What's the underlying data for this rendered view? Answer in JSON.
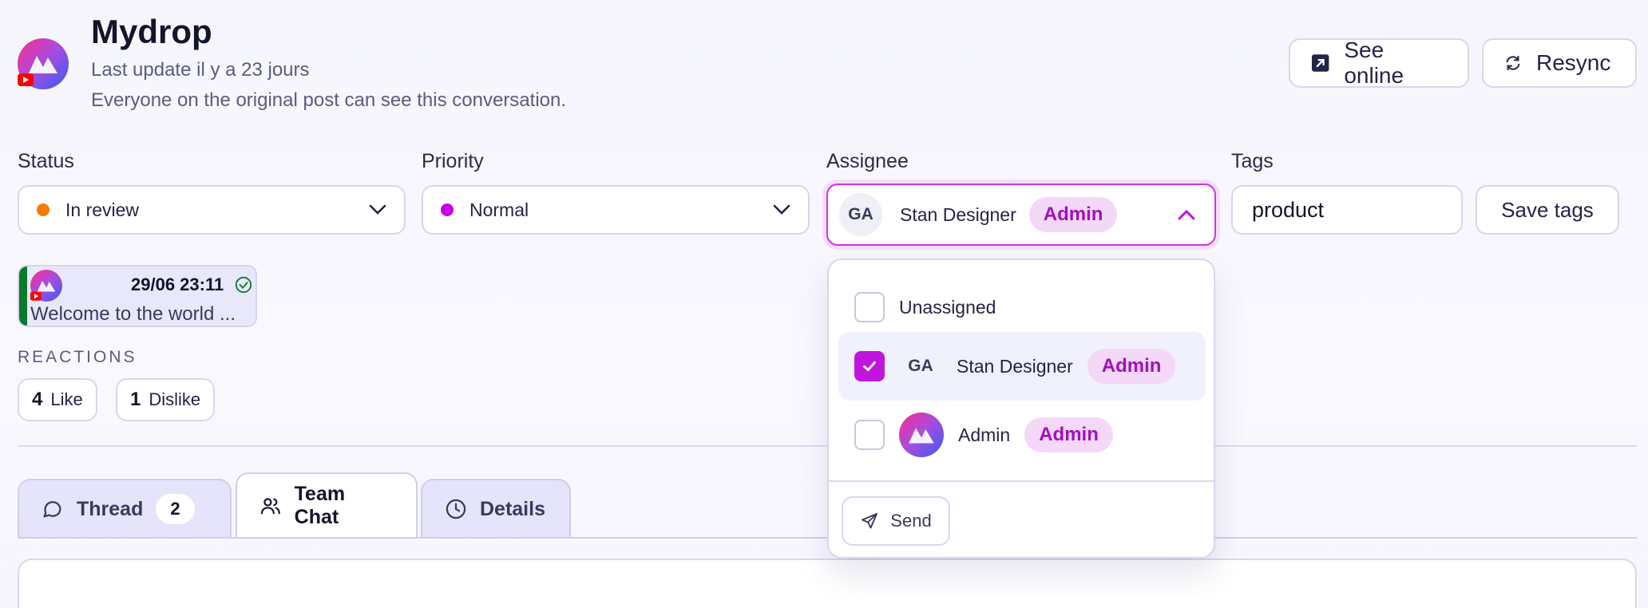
{
  "header": {
    "title": "Mydrop",
    "last_update": "Last update il y a 23 jours",
    "visibility_note": "Everyone on the original post can see this conversation.",
    "see_online_label": "See online",
    "resync_label": "Resync"
  },
  "fields": {
    "status": {
      "label": "Status",
      "value": "In review",
      "dot_color": "#f57c00"
    },
    "priority": {
      "label": "Priority",
      "value": "Normal",
      "dot_color": "#c800e8"
    },
    "assignee": {
      "label": "Assignee",
      "initials": "GA",
      "name": "Stan Designer",
      "role": "Admin"
    },
    "tags": {
      "label": "Tags",
      "value": "product",
      "save_label": "Save tags"
    }
  },
  "message": {
    "date": "29/06 23:11",
    "preview": "Welcome to the world ..."
  },
  "reactions": {
    "title": "REACTIONS",
    "items": [
      {
        "count": "4",
        "label": "Like"
      },
      {
        "count": "1",
        "label": "Dislike"
      }
    ]
  },
  "tabs": [
    {
      "label": "Thread",
      "count": "2",
      "icon": "chat-bubble-icon"
    },
    {
      "label": "Team Chat",
      "icon": "users-icon",
      "active": true
    },
    {
      "label": "Details",
      "icon": "clock-icon"
    }
  ],
  "dropdown": {
    "options": [
      {
        "label": "Unassigned",
        "checked": false
      },
      {
        "initials": "GA",
        "label": "Stan Designer",
        "role": "Admin",
        "checked": true
      },
      {
        "label": "Admin",
        "role": "Admin",
        "checked": false,
        "avatar": "brand-logo"
      }
    ],
    "send_label": "Send"
  },
  "colors": {
    "accent": "#c115dd",
    "badge_bg": "#f4d8f8",
    "badge_text": "#a30fc0",
    "youtube_red": "#ff0000",
    "channel_green": "#0b7a2a"
  }
}
